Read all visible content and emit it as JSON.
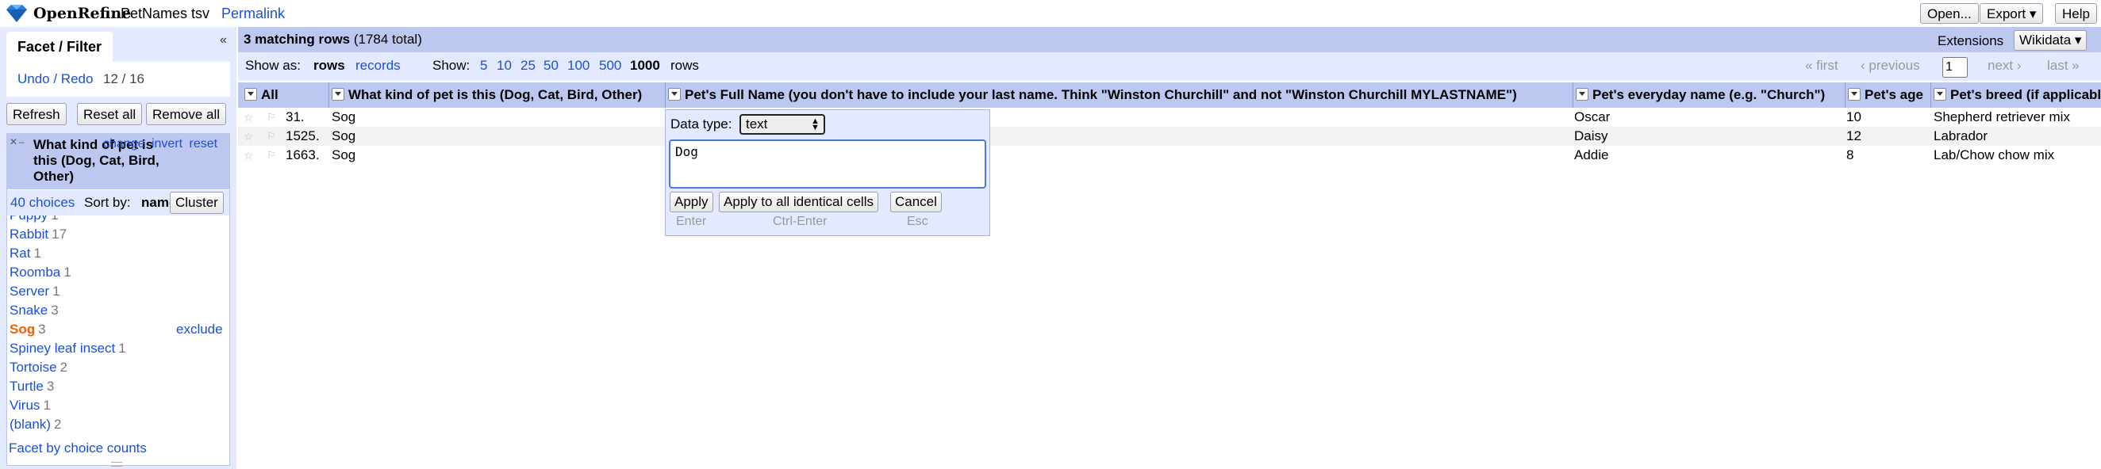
{
  "header": {
    "brand": "OpenRefine",
    "project_name": "PetNames tsv",
    "permalink": "Permalink",
    "buttons": {
      "open": "Open...",
      "export": "Export ▾",
      "help": "Help"
    }
  },
  "left_panel": {
    "tab_label": "Facet / Filter",
    "collapse_icon": "«",
    "undo_label": "Undo / Redo",
    "undo_count": "12 / 16",
    "buttons": {
      "refresh": "Refresh",
      "reset_all": "Reset all",
      "remove_all": "Remove all"
    },
    "facet": {
      "title": "What kind of pet is this (Dog, Cat, Bird, Other)",
      "actions": [
        "change",
        "invert",
        "reset"
      ],
      "choices_count": "40 choices",
      "sort_by": "Sort by:",
      "sort_value": "name",
      "cluster_label": "Cluster",
      "choices": [
        {
          "name": "Puppy",
          "count": "1"
        },
        {
          "name": "Rabbit",
          "count": "17"
        },
        {
          "name": "Rat",
          "count": "1"
        },
        {
          "name": "Roomba",
          "count": "1"
        },
        {
          "name": "Server",
          "count": "1"
        },
        {
          "name": "Snake",
          "count": "3"
        },
        {
          "name": "Sog",
          "count": "3",
          "selected": true,
          "extra": "exclude"
        },
        {
          "name": "Spiney leaf insect",
          "count": "1"
        },
        {
          "name": "Tortoise",
          "count": "2"
        },
        {
          "name": "Turtle",
          "count": "3"
        },
        {
          "name": "Virus",
          "count": "1"
        },
        {
          "name": "(blank)",
          "count": "2"
        }
      ],
      "footer_link": "Facet by choice counts"
    }
  },
  "summary": {
    "matching": "3 matching rows",
    "total": " (1784 total)"
  },
  "toolbar_right": {
    "extensions": "Extensions",
    "wikidata": "Wikidata ▾"
  },
  "view_bar": {
    "show_as": "Show as:",
    "rows": "rows",
    "records": "records",
    "show": "Show:",
    "page_sizes": [
      "5",
      "10",
      "25",
      "50",
      "100",
      "500",
      "1000"
    ],
    "active_page_size": "1000",
    "rows_label": "rows",
    "first": "« first",
    "prev": "‹ previous",
    "page": "1",
    "next": "next ›",
    "last": "last »"
  },
  "table": {
    "columns": [
      "All",
      "What kind of pet is this (Dog, Cat, Bird, Other)",
      "Pet's Full Name (you don't have to include your last name. Think \"Winston Churchill\" and not \"Winston Churchill MYLASTNAME\")",
      "Pet's everyday name (e.g. \"Church\")",
      "Pet's age",
      "Pet's breed (if applicable)"
    ],
    "rows": [
      {
        "index": "31.",
        "kind": "Sog",
        "full_name": "",
        "everyday": "Oscar",
        "age": "10",
        "breed": "Shepherd retriever mix"
      },
      {
        "index": "1525.",
        "kind": "Sog",
        "full_name": "",
        "everyday": "Daisy",
        "age": "12",
        "breed": "Labrador"
      },
      {
        "index": "1663.",
        "kind": "Sog",
        "full_name": "",
        "everyday": "Addie",
        "age": "8",
        "breed": "Lab/Chow chow mix"
      }
    ]
  },
  "editor": {
    "data_type_label": "Data type:",
    "data_type_value": "text",
    "value": "Dog",
    "buttons": {
      "apply": "Apply",
      "apply_all": "Apply to all identical cells",
      "cancel": "Cancel"
    },
    "hints": {
      "apply": "Enter",
      "apply_all": "Ctrl-Enter",
      "cancel": "Esc"
    }
  }
}
